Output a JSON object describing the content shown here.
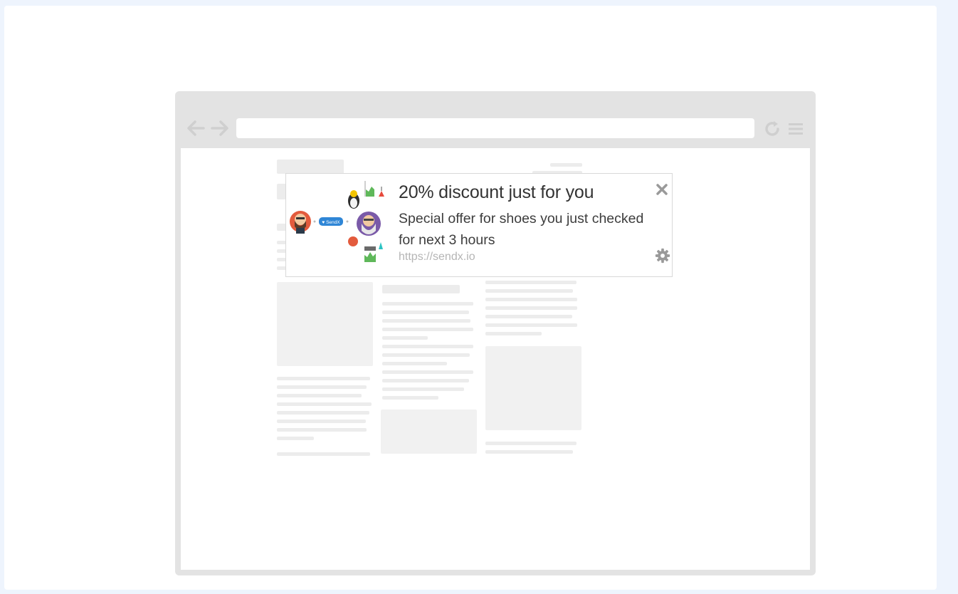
{
  "notification": {
    "title": "20% discount just for you",
    "body": "Special offer for shoes you just checked for next 3 hours",
    "url": "https://sendx.io",
    "badge_label": "♥ SendX"
  },
  "icons": {
    "close": "close-icon",
    "settings": "gear-icon",
    "back": "back-arrow-icon",
    "forward": "forward-arrow-icon",
    "reload": "reload-icon",
    "menu": "hamburger-menu-icon"
  },
  "colors": {
    "page_bg": "#eef4fd",
    "browser_frame": "#e3e3e3",
    "skeleton": "#ececec",
    "badge": "#2f86d6",
    "icon_gray": "#9a9a9a"
  }
}
